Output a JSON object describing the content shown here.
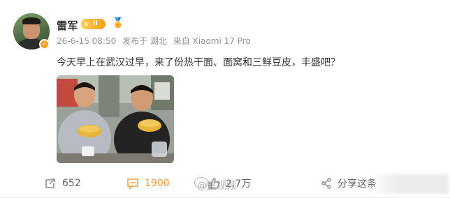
{
  "post": {
    "user": {
      "name": "雷军",
      "vip_level": "II",
      "avatar_icon": "person-avatar",
      "verified_icon": "verified-badge-icon"
    },
    "meta": {
      "timestamp": "26-6-15 08:50",
      "location": "发布于 湖北",
      "source": "来自 Xiaomi 17 Pro"
    },
    "text": "今天早上在武汉过早，来了份热干面、面窝和三鲜豆皮，丰盛吧？",
    "image": {
      "description_icon": "photo-two-men-eating-noodles"
    }
  },
  "actions": {
    "repost": {
      "icon": "repost-icon",
      "count": "652"
    },
    "comment": {
      "icon": "comment-icon",
      "count": "1900",
      "color": "#f0a040"
    },
    "like": {
      "icon": "like-icon",
      "count": "2.7万"
    },
    "share": {
      "icon": "share-icon",
      "label": "分享这条"
    }
  },
  "watermark": {
    "text": "@星视频"
  },
  "colors": {
    "name": "#333333",
    "meta": "#939393",
    "accent": "#f0a040",
    "vip": "#f59e1b"
  }
}
